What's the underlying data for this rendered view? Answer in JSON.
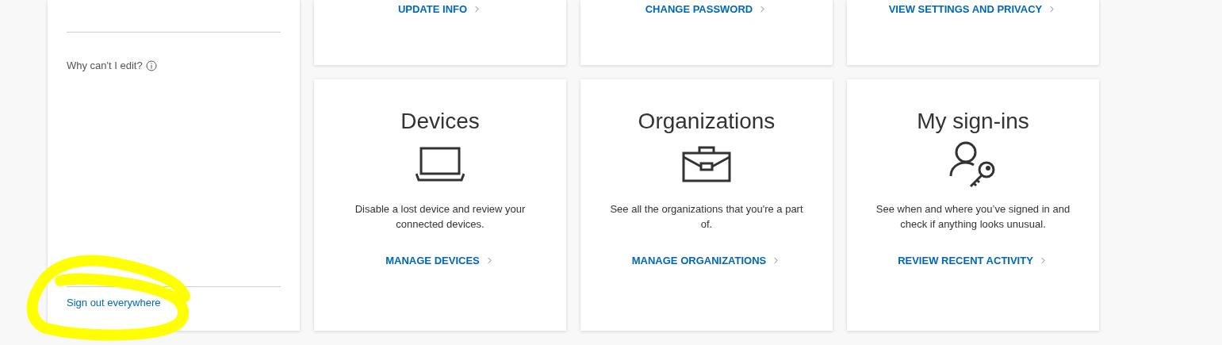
{
  "sidebar": {
    "help_link": "Why can't I edit?",
    "sign_out_link": "Sign out everywhere"
  },
  "top_cards": [
    {
      "link": "UPDATE INFO"
    },
    {
      "link": "CHANGE PASSWORD"
    },
    {
      "link": "VIEW SETTINGS AND PRIVACY"
    }
  ],
  "cards": [
    {
      "kind": "laptop",
      "title": "Devices",
      "description": "Disable a lost device and review your connected devices.",
      "link": "MANAGE DEVICES"
    },
    {
      "kind": "briefcase",
      "title": "Organizations",
      "description": "See all the organizations that you're a part of.",
      "link": "MANAGE ORGANIZATIONS"
    },
    {
      "kind": "user-key",
      "title": "My sign-ins",
      "description": "See when and where you’ve signed in and check if anything looks unusual.",
      "link": "REVIEW RECENT ACTIVITY"
    }
  ]
}
